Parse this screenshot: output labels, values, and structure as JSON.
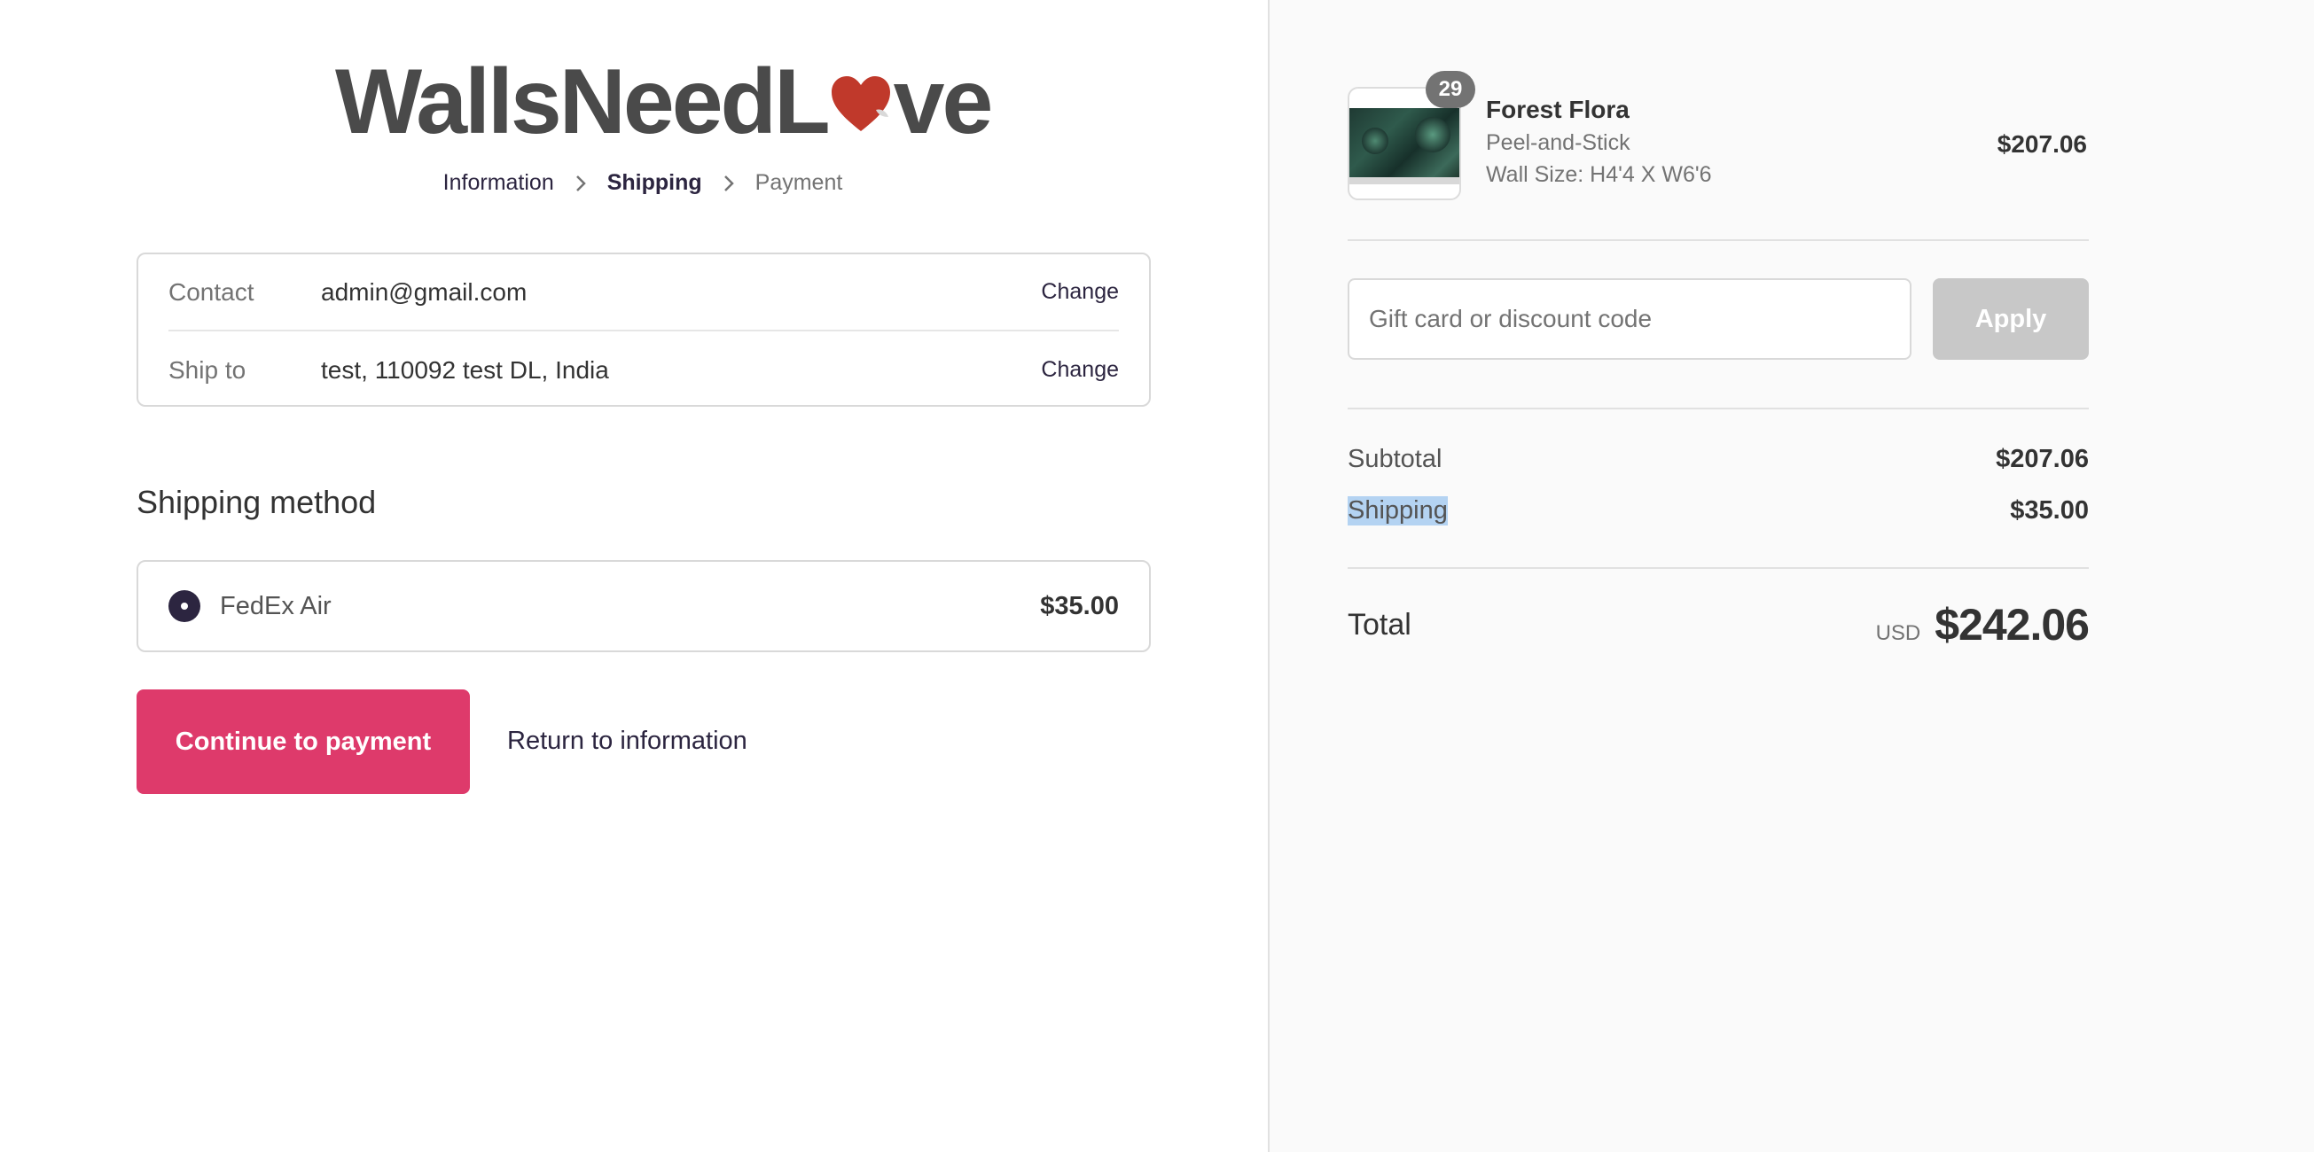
{
  "brand": {
    "logo_before": "WallsNeedL",
    "logo_after": "ve",
    "heart_color": "#c0392b"
  },
  "breadcrumb": {
    "items": [
      {
        "label": "Information"
      },
      {
        "label": "Shipping"
      },
      {
        "label": "Payment"
      }
    ]
  },
  "review": {
    "contact": {
      "label": "Contact",
      "value": "admin@gmail.com",
      "action": "Change"
    },
    "ship_to": {
      "label": "Ship to",
      "value": "test, 110092 test DL, India",
      "action": "Change"
    }
  },
  "shipping_method": {
    "title": "Shipping method",
    "option": {
      "label": "FedEx Air",
      "price": "$35.00",
      "selected": true
    }
  },
  "actions": {
    "continue_label": "Continue to payment",
    "return_label": "Return to information"
  },
  "order": {
    "product": {
      "quantity": "29",
      "name": "Forest Flora",
      "variant": "Peel-and-Stick",
      "size": "Wall Size: H4'4 X W6'6",
      "price": "$207.06"
    },
    "discount": {
      "placeholder": "Gift card or discount code",
      "apply_label": "Apply"
    },
    "subtotal": {
      "label": "Subtotal",
      "value": "$207.06"
    },
    "shipping": {
      "label": "Shipping",
      "value": "$35.00"
    },
    "total": {
      "label": "Total",
      "currency": "USD",
      "value": "$242.06"
    }
  },
  "colors": {
    "accent": "#de3a6b",
    "dark": "#2c2540",
    "apply_disabled": "#c8c8c8",
    "selection_highlight": "#b4d3f2"
  }
}
